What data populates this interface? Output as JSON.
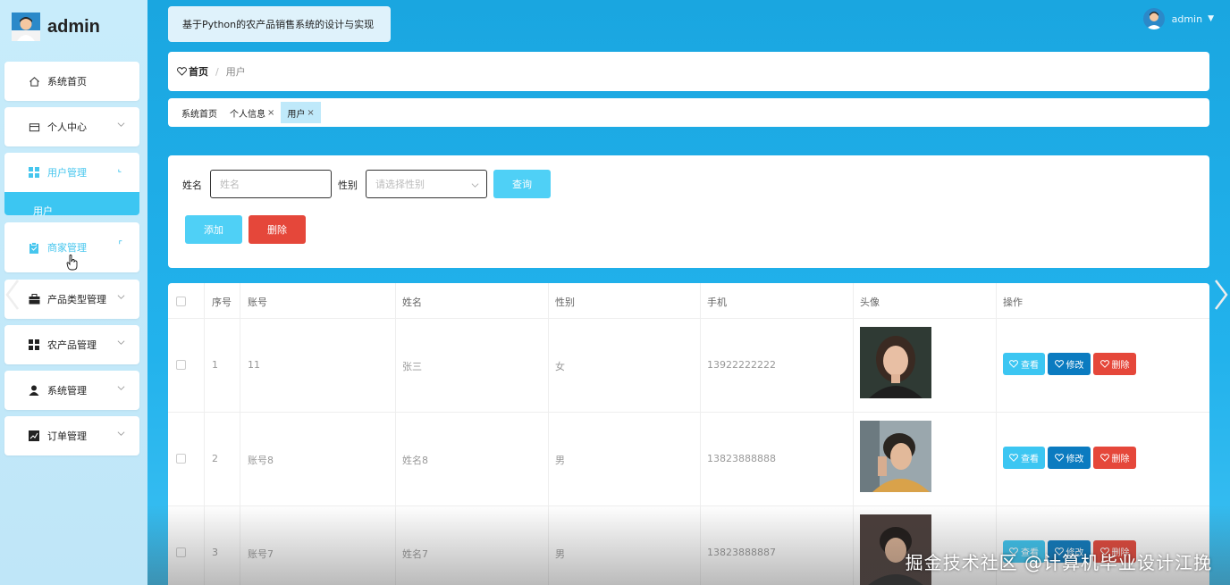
{
  "brand": {
    "name": "admin"
  },
  "sidebar": {
    "items": [
      {
        "label": "系统首页"
      },
      {
        "label": "个人中心"
      },
      {
        "label": "用户管理"
      },
      {
        "label": "商家管理"
      },
      {
        "label": "产品类型管理"
      },
      {
        "label": "农产品管理"
      },
      {
        "label": "系统管理"
      },
      {
        "label": "订单管理"
      }
    ],
    "sub_item": "用户"
  },
  "header": {
    "title": "基于Python的农产品销售系统的设计与实现",
    "user": "admin"
  },
  "breadcrumb": {
    "home": "首页",
    "separator": "/",
    "current": "用户"
  },
  "tags": [
    {
      "label": "系统首页"
    },
    {
      "label": "个人信息",
      "close": "×"
    },
    {
      "label": "用户",
      "close": "×"
    }
  ],
  "search": {
    "name_label": "姓名",
    "name_placeholder": "姓名",
    "gender_label": "性别",
    "gender_placeholder": "请选择性别",
    "query_button": "查询",
    "add_button": "添加",
    "delete_button": "删除"
  },
  "table": {
    "headers": [
      "序号",
      "账号",
      "姓名",
      "性别",
      "手机",
      "头像",
      "操作"
    ],
    "rows": [
      {
        "index": "1",
        "account": "11",
        "name": "张三",
        "gender": "女",
        "phone": "13922222222"
      },
      {
        "index": "2",
        "account": "账号8",
        "name": "姓名8",
        "gender": "男",
        "phone": "13823888888"
      },
      {
        "index": "3",
        "account": "账号7",
        "name": "姓名7",
        "gender": "男",
        "phone": "13823888887"
      }
    ],
    "actions": {
      "view": "查看",
      "edit": "修改",
      "delete": "删除"
    }
  },
  "watermark": "掘金技术社区 @计算机毕业设计江挽",
  "colors": {
    "accent": "#3cc6f2",
    "edit": "#0b7bc0",
    "danger": "#e5473a"
  }
}
